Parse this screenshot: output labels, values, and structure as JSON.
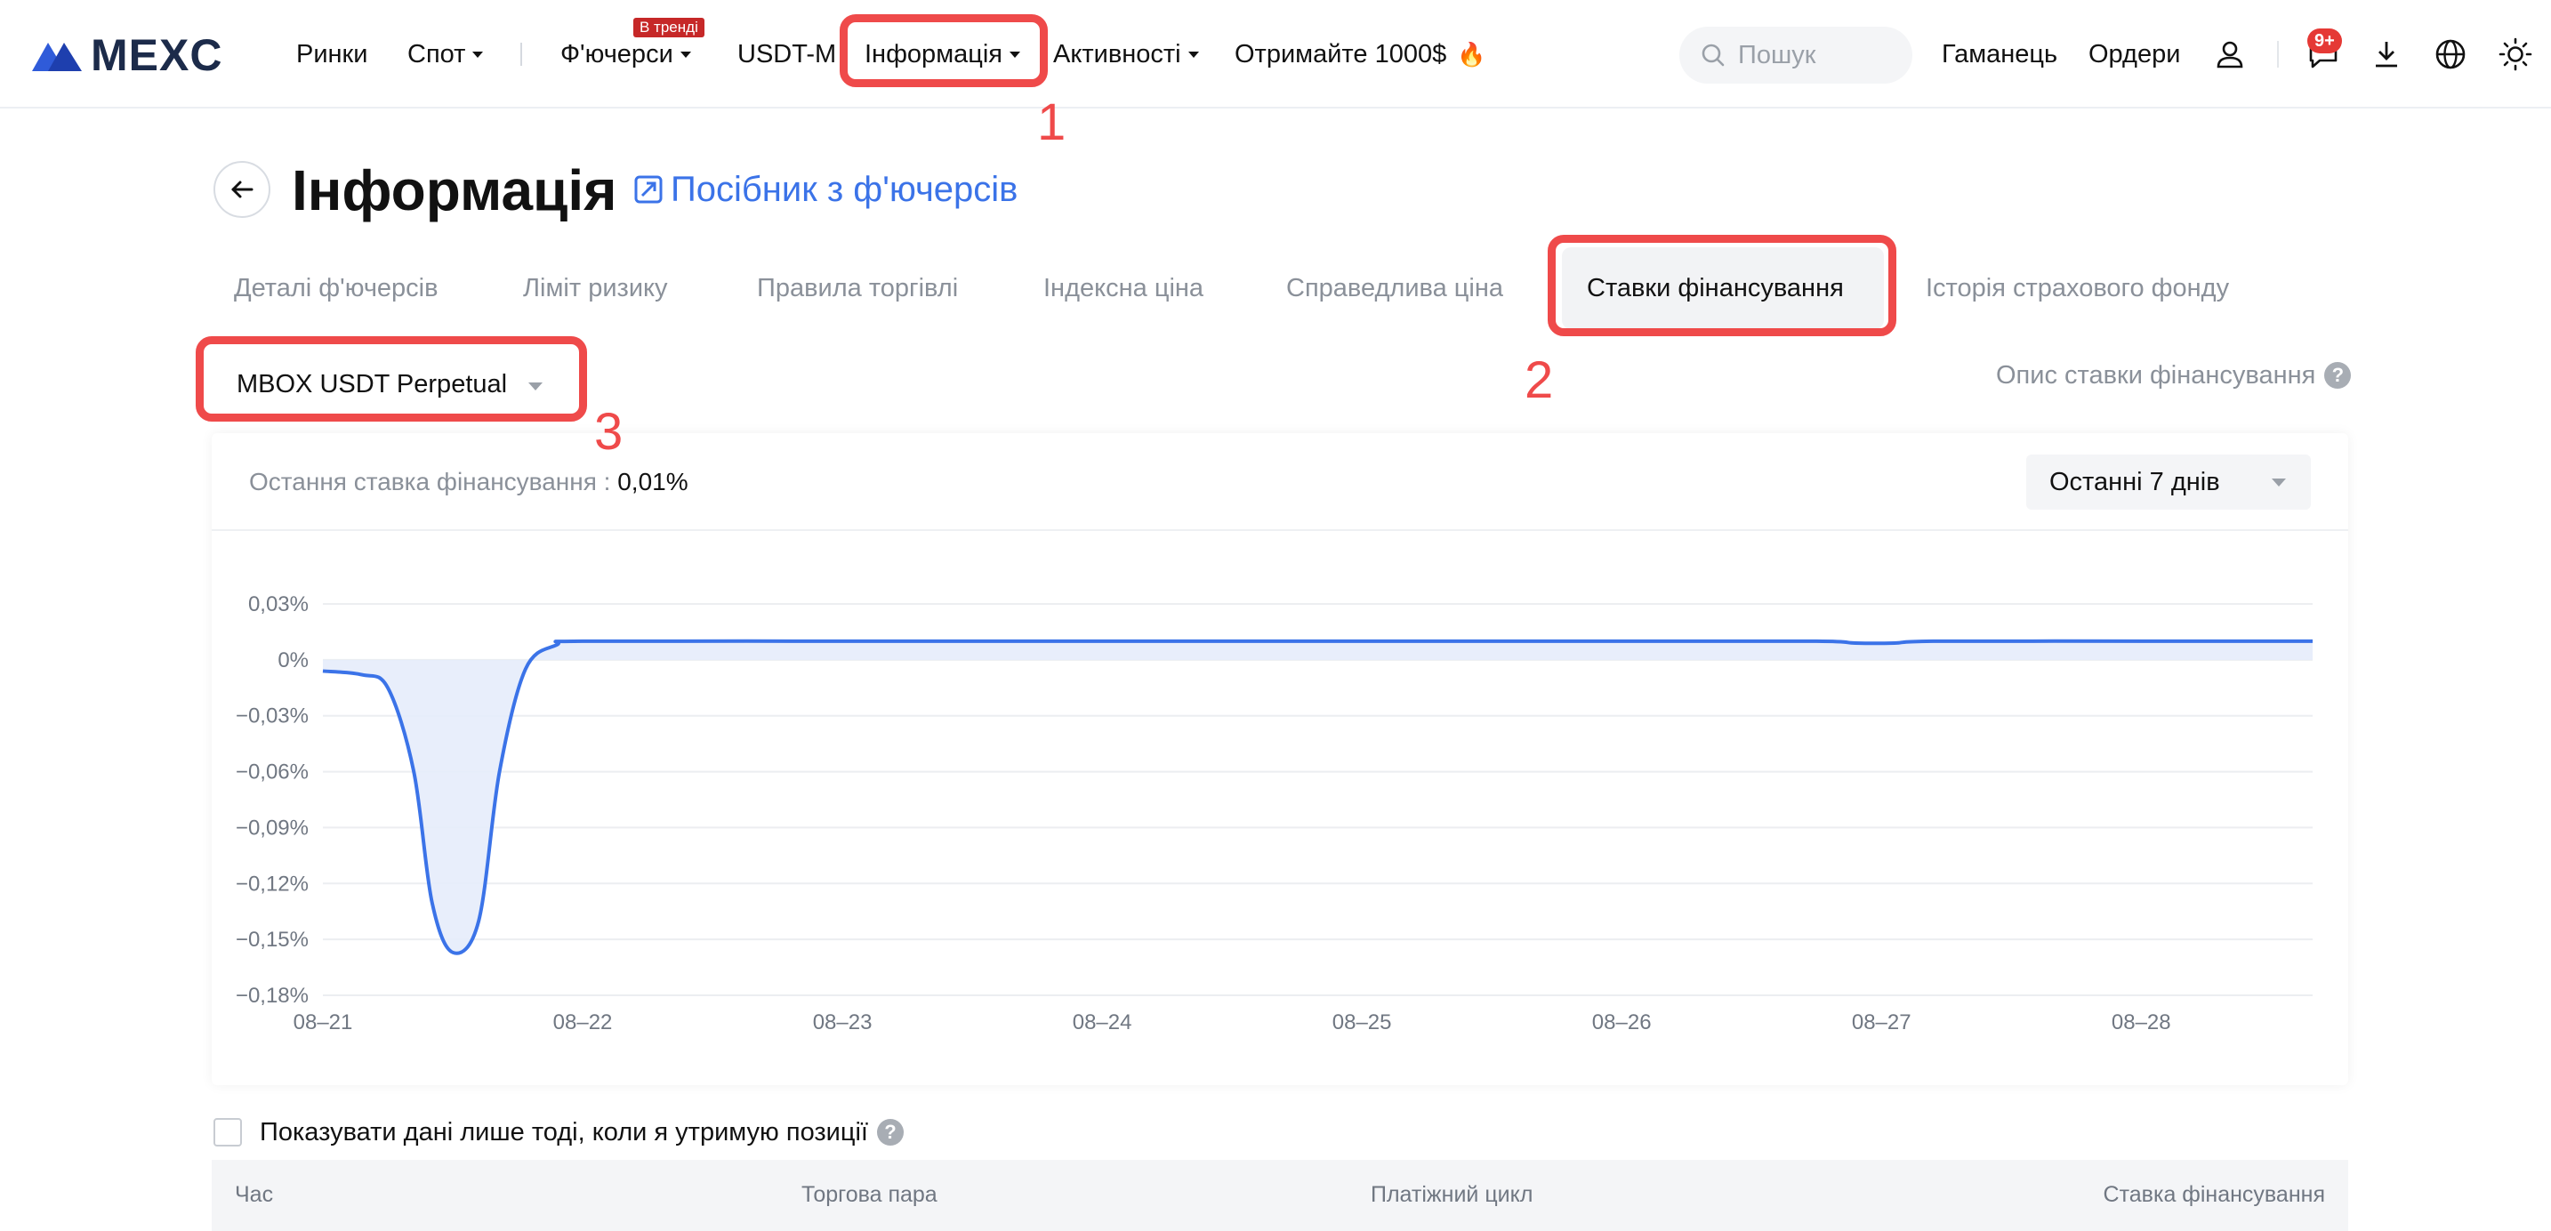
{
  "header": {
    "logo_text": "MEXC",
    "nav": {
      "markets": "Ринки",
      "spot": "Спот",
      "futures": "Ф'ючерси",
      "trend_badge": "В тренді",
      "usdt_m": "USDT-M",
      "info": "Інформація",
      "activities": "Активності",
      "promo": "Отримайте 1000$"
    },
    "search_placeholder": "Пошук",
    "wallet": "Гаманець",
    "orders": "Ордери",
    "notif_count": "9+"
  },
  "annotations": [
    "1",
    "2",
    "3"
  ],
  "page": {
    "title": "Інформація",
    "guide_link": "Посібник з ф'ючерсів"
  },
  "tabs": [
    {
      "label": "Деталі ф'ючерсів"
    },
    {
      "label": "Ліміт ризику"
    },
    {
      "label": "Правила торгівлі"
    },
    {
      "label": "Індексна ціна"
    },
    {
      "label": "Справедлива ціна"
    },
    {
      "label": "Ставки фінансування"
    },
    {
      "label": "Історія страхового фонду"
    }
  ],
  "contract": {
    "selected": "MBOX USDT Perpetual"
  },
  "rate_description": "Опис ставки фінансування",
  "chart_card": {
    "last_rate_label": "Остання ставка фінансування :",
    "last_rate_value": "0,01%",
    "period": "Останні 7 днів"
  },
  "chart_data": {
    "type": "area",
    "title": "",
    "xlabel": "",
    "ylabel": "",
    "y_unit": "%",
    "ylim": [
      -0.18,
      0.03
    ],
    "y_ticks": [
      "0,03%",
      "0%",
      "−0,03%",
      "−0,06%",
      "−0,09%",
      "−0,12%",
      "−0,15%",
      "−0,18%"
    ],
    "y_tick_values": [
      0.03,
      0,
      -0.03,
      -0.06,
      -0.09,
      -0.12,
      -0.15,
      -0.18
    ],
    "x_ticks": [
      "08–21",
      "08–22",
      "08–23",
      "08–24",
      "08–25",
      "08–26",
      "08–27",
      "08–28"
    ],
    "grid": true,
    "line_color": "#3b73e8",
    "fill_color": "#e6ecfb",
    "series": [
      {
        "points": [
          [
            0,
            -0.006
          ],
          [
            0.15,
            -0.008
          ],
          [
            0.25,
            -0.015
          ],
          [
            0.35,
            -0.06
          ],
          [
            0.42,
            -0.13
          ],
          [
            0.5,
            -0.157
          ],
          [
            0.6,
            -0.14
          ],
          [
            0.68,
            -0.06
          ],
          [
            0.78,
            -0.005
          ],
          [
            0.9,
            0.008
          ],
          [
            1.0,
            0.01
          ],
          [
            2.0,
            0.01
          ],
          [
            3.0,
            0.01
          ],
          [
            4.0,
            0.01
          ],
          [
            5.0,
            0.01
          ],
          [
            5.75,
            0.01
          ],
          [
            5.9,
            0.009
          ],
          [
            6.05,
            0.009
          ],
          [
            6.2,
            0.01
          ],
          [
            7.0,
            0.01
          ],
          [
            7.66,
            0.01
          ]
        ]
      }
    ]
  },
  "filter": {
    "only_positions_label": "Показувати дані лише тоді, коли я утримую позиції"
  },
  "table": {
    "headers": [
      "Час",
      "Торгова пара",
      "Платіжний цикл",
      "Ставка фінансування"
    ]
  }
}
